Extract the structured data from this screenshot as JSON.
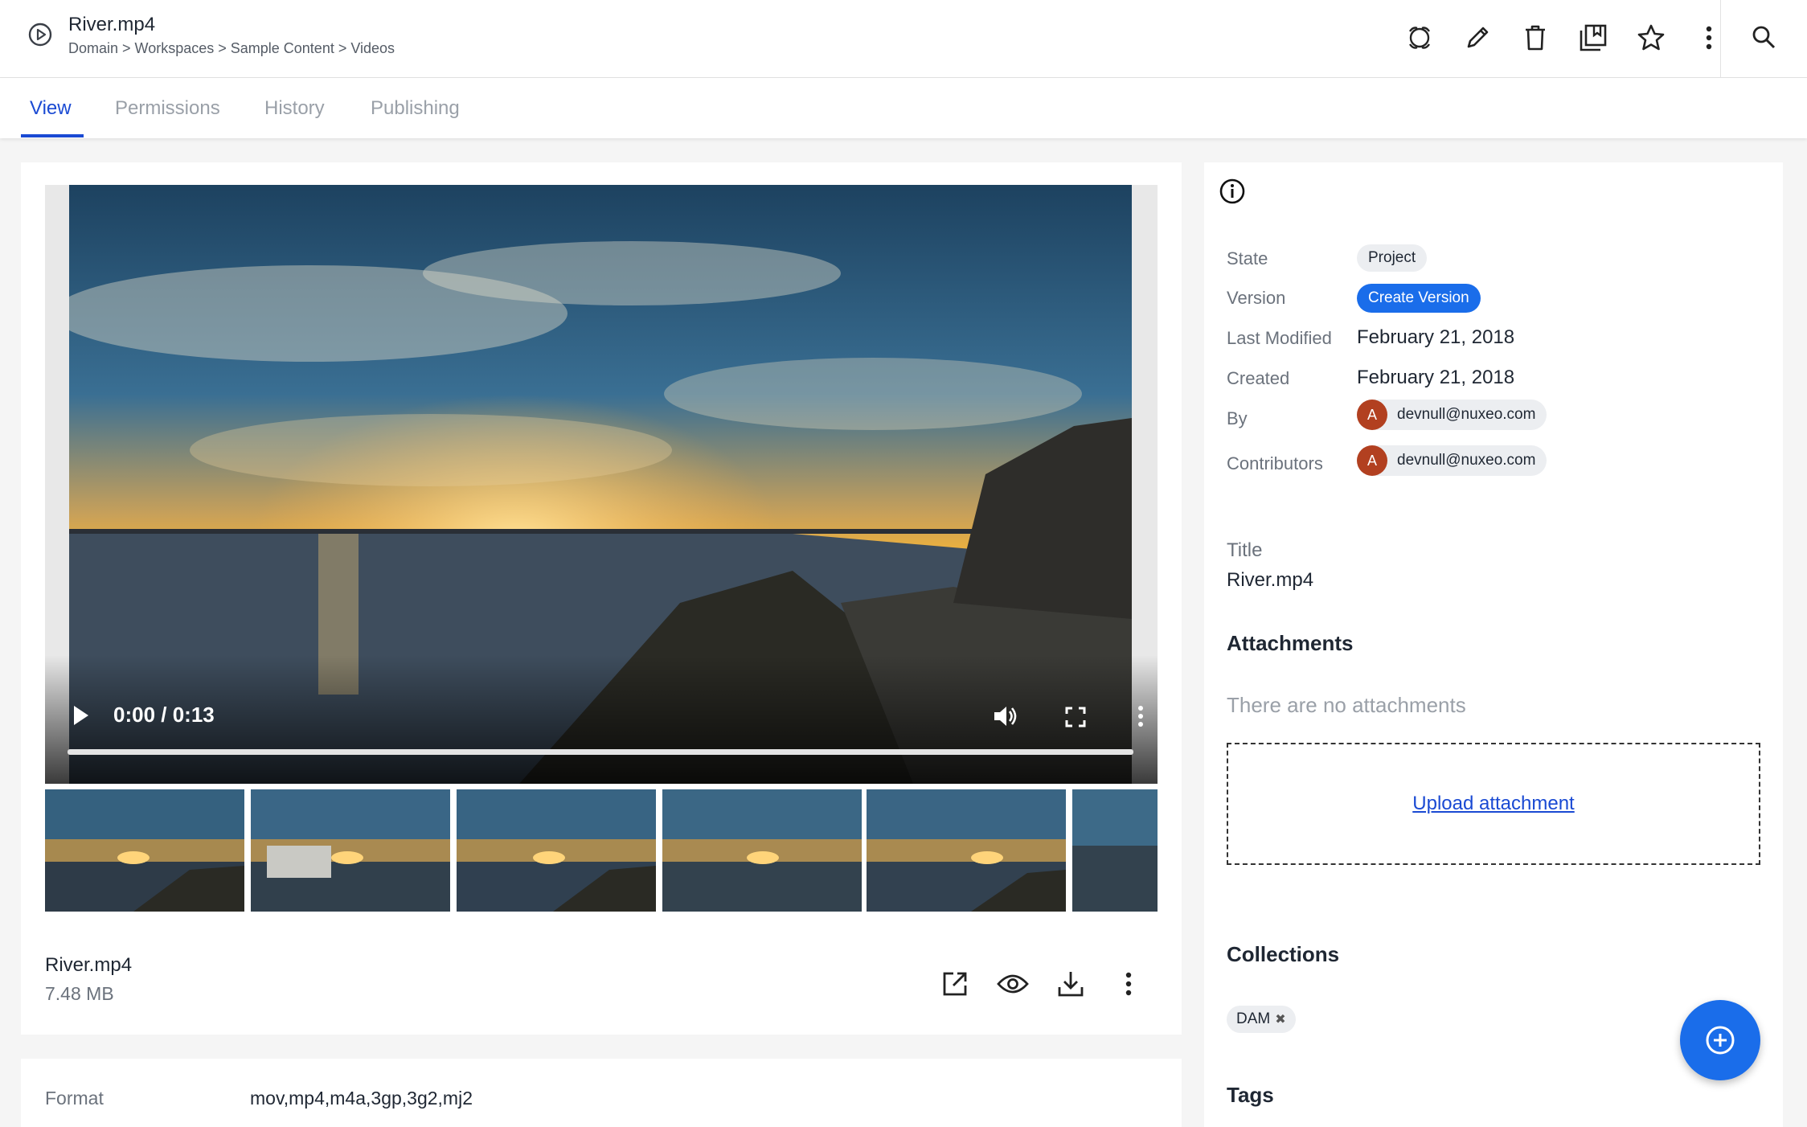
{
  "document": {
    "title": "River.mp4",
    "breadcrumb": "Domain > Workspaces > Sample Content > Videos"
  },
  "header_actions": [
    "lifecycle-icon",
    "edit-icon",
    "delete-icon",
    "collection-icon",
    "favorite-icon",
    "more-icon"
  ],
  "tabs": [
    {
      "label": "View",
      "active": true
    },
    {
      "label": "Permissions",
      "active": false
    },
    {
      "label": "History",
      "active": false
    },
    {
      "label": "Publishing",
      "active": false
    }
  ],
  "player": {
    "time": "0:00 / 0:13"
  },
  "file": {
    "name": "River.mp4",
    "size": "7.48 MB"
  },
  "metadata": {
    "format_label": "Format",
    "format_value": "mov,mp4,m4a,3gp,3g2,mj2"
  },
  "properties": {
    "state_label": "State",
    "state_value": "Project",
    "version_label": "Version",
    "version_button": "Create Version",
    "modified_label": "Last Modified",
    "modified_value": "February 21, 2018",
    "created_label": "Created",
    "created_value": "February 21, 2018",
    "by_label": "By",
    "by_user": "devnull@nuxeo.com",
    "contributors_label": "Contributors",
    "contributor_user": "devnull@nuxeo.com",
    "avatar_letter": "A"
  },
  "title_section": {
    "label": "Title",
    "value": "River.mp4"
  },
  "attachments": {
    "heading": "Attachments",
    "empty": "There are no attachments",
    "upload": "Upload attachment"
  },
  "collections": {
    "heading": "Collections",
    "items": [
      "DAM"
    ]
  },
  "tags": {
    "heading": "Tags"
  },
  "colors": {
    "accent": "#1a4ad3",
    "button": "#1a6dea",
    "avatar": "#b24020"
  }
}
